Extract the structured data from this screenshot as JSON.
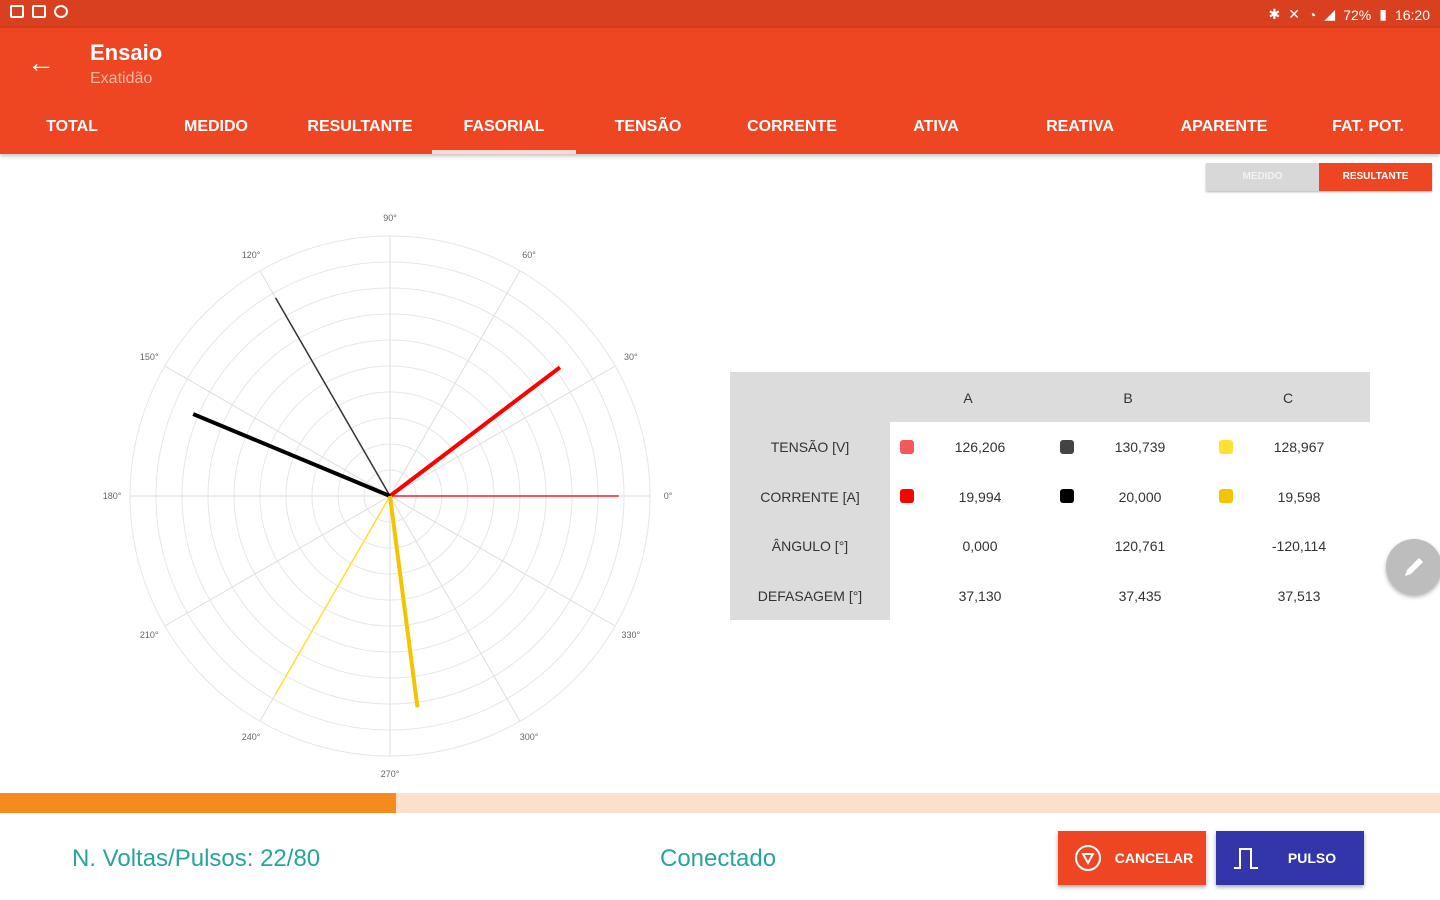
{
  "status": {
    "battery": "72%",
    "time": "16:20"
  },
  "header": {
    "title": "Ensaio",
    "subtitle": "Exatidão"
  },
  "tabs": [
    {
      "label": "TOTAL"
    },
    {
      "label": "MEDIDO"
    },
    {
      "label": "RESULTANTE"
    },
    {
      "label": "FASORIAL",
      "active": true
    },
    {
      "label": "TENSÃO"
    },
    {
      "label": "CORRENTE"
    },
    {
      "label": "ATIVA"
    },
    {
      "label": "REATIVA"
    },
    {
      "label": "APARENTE"
    },
    {
      "label": "FAT. POT."
    }
  ],
  "toggle": {
    "left": "MEDIDO",
    "right": "RESULTANTE",
    "selected": "RESULTANTE"
  },
  "chart_data": {
    "type": "polar",
    "angle_labels": [
      "0°",
      "30°",
      "60°",
      "90°",
      "120°",
      "150°",
      "180°",
      "210°",
      "240°",
      "270°",
      "300°",
      "330°"
    ],
    "rings": 10,
    "phasors": [
      {
        "phase": "A",
        "kind": "tensão",
        "angle": 0,
        "magnitude": 1.0,
        "color": "#ff1a1a"
      },
      {
        "phase": "B",
        "kind": "tensão",
        "angle": 120,
        "magnitude": 1.0,
        "color": "#333333"
      },
      {
        "phase": "C",
        "kind": "tensão",
        "angle": 240,
        "magnitude": 1.0,
        "color": "#ffe033"
      },
      {
        "phase": "A",
        "kind": "corrente",
        "angle": 37.13,
        "magnitude": 0.82,
        "color": "#ff0000"
      },
      {
        "phase": "B",
        "kind": "corrente",
        "angle": 157.4,
        "magnitude": 0.82,
        "color": "#000000"
      },
      {
        "phase": "C",
        "kind": "corrente",
        "angle": 277.4,
        "magnitude": 0.82,
        "color": "#f5c400"
      }
    ]
  },
  "table": {
    "headers": [
      "A",
      "B",
      "C"
    ],
    "rows": [
      {
        "label": "TENSÃO [V]",
        "values": [
          "126,206",
          "130,739",
          "128,967"
        ],
        "swatches": [
          "#f25a5a",
          "#444444",
          "#ffe033"
        ]
      },
      {
        "label": "CORRENTE [A]",
        "values": [
          "19,994",
          "20,000",
          "19,598"
        ],
        "swatches": [
          "#ff0000",
          "#000000",
          "#f5c400"
        ]
      },
      {
        "label": "ÂNGULO [°]",
        "values": [
          "0,000",
          "120,761",
          "-120,114"
        ]
      },
      {
        "label": "DEFASAGEM [°]",
        "values": [
          "37,130",
          "37,435",
          "37,513"
        ]
      }
    ]
  },
  "progress": {
    "value": 0.275
  },
  "footer": {
    "pulses": "N. Voltas/Pulsos: 22/80",
    "connection": "Conectado",
    "cancel_label": "CANCELAR",
    "pulse_label": "PULSO"
  }
}
